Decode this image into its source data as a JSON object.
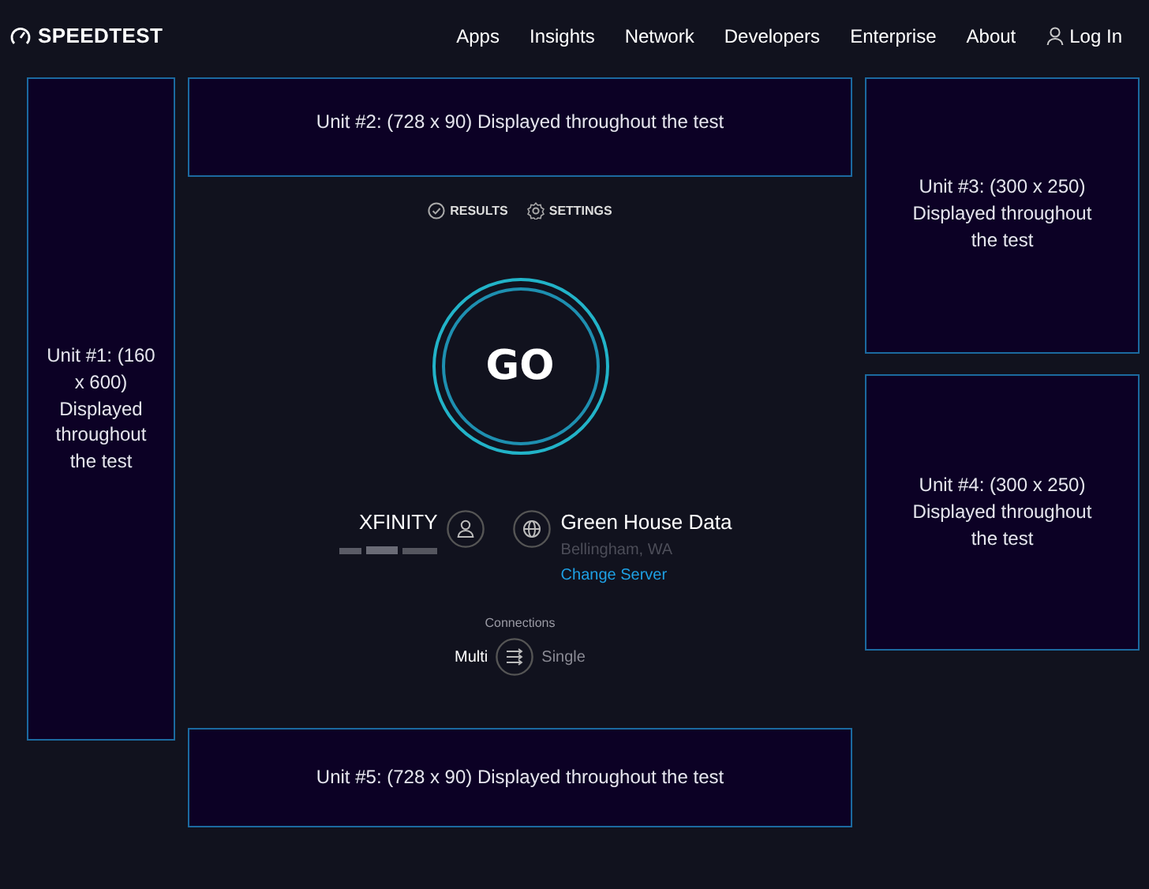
{
  "header": {
    "logo": "SPEEDTEST",
    "nav": [
      {
        "label": "Apps"
      },
      {
        "label": "Insights"
      },
      {
        "label": "Network"
      },
      {
        "label": "Developers"
      },
      {
        "label": "Enterprise"
      },
      {
        "label": "About"
      }
    ],
    "login": "Log In"
  },
  "ads": [
    {
      "text": "Unit #1: (160 x 600) Displayed throughout the test"
    },
    {
      "text": "Unit #2: (728 x 90) Displayed throughout the test"
    },
    {
      "text": "Unit #3: (300 x 250) Displayed throughout the test"
    },
    {
      "text": "Unit #4: (300 x 250) Displayed throughout the test"
    },
    {
      "text": "Unit #5: (728 x 90) Displayed throughout the test"
    }
  ],
  "test_links": [
    {
      "label": "RESULTS",
      "kind": "results"
    },
    {
      "label": "SETTINGS",
      "kind": "settings"
    }
  ],
  "go_button": "GO",
  "isp": {
    "name": "XFINITY"
  },
  "server": {
    "name": "Green House Data",
    "location": "Bellingham, WA",
    "link": "Change Server"
  },
  "connections": {
    "label": "Connections",
    "options": [
      {
        "label": "Multi",
        "selected": true
      },
      {
        "label": "Single",
        "selected": false
      }
    ]
  }
}
